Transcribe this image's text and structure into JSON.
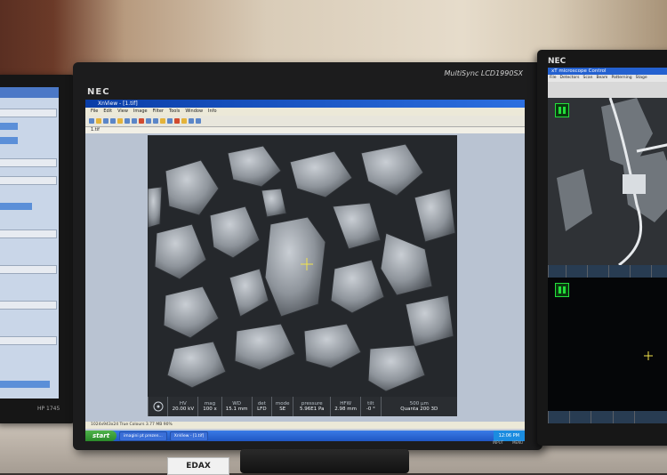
{
  "main_monitor": {
    "brand": "NEC",
    "model": "MultiSync LCD1990SX"
  },
  "xtview": {
    "window_title": "XnView - [1.tif]",
    "menu": [
      "File",
      "Edit",
      "View",
      "Image",
      "Filter",
      "Tools",
      "Window",
      "Info"
    ],
    "tab": "1.tif",
    "status_text": "1024x943x24  True Colours  3.77 MB  90%",
    "databar": [
      {
        "key": "HV",
        "value": "20.00 kV"
      },
      {
        "key": "mag",
        "value": "100 x"
      },
      {
        "key": "WD",
        "value": "15.1 mm"
      },
      {
        "key": "det",
        "value": "LFD"
      },
      {
        "key": "mode",
        "value": "SE"
      },
      {
        "key": "pressure",
        "value": "5.96E1 Pa"
      },
      {
        "key": "HFW",
        "value": "2.98 mm"
      },
      {
        "key": "tilt",
        "value": "-0 °"
      },
      {
        "key": "500 µm",
        "value": "Quanta 200 3D"
      }
    ]
  },
  "taskbar": {
    "start": "start",
    "tasks": [
      "imagini pt prezen...",
      "XnView - [1.tif]"
    ],
    "clock": "12:06 PM"
  },
  "monitor_buttons": [
    "INPUT",
    "MENU"
  ],
  "right_monitor": {
    "brand": "NEC",
    "window_title": "xT microscope Control",
    "menu": [
      "File",
      "Detectors",
      "Scan",
      "Beam",
      "Patterning",
      "Stage"
    ]
  },
  "left_monitor": {
    "label": "HP 1745"
  },
  "stand_label": "EDAX"
}
